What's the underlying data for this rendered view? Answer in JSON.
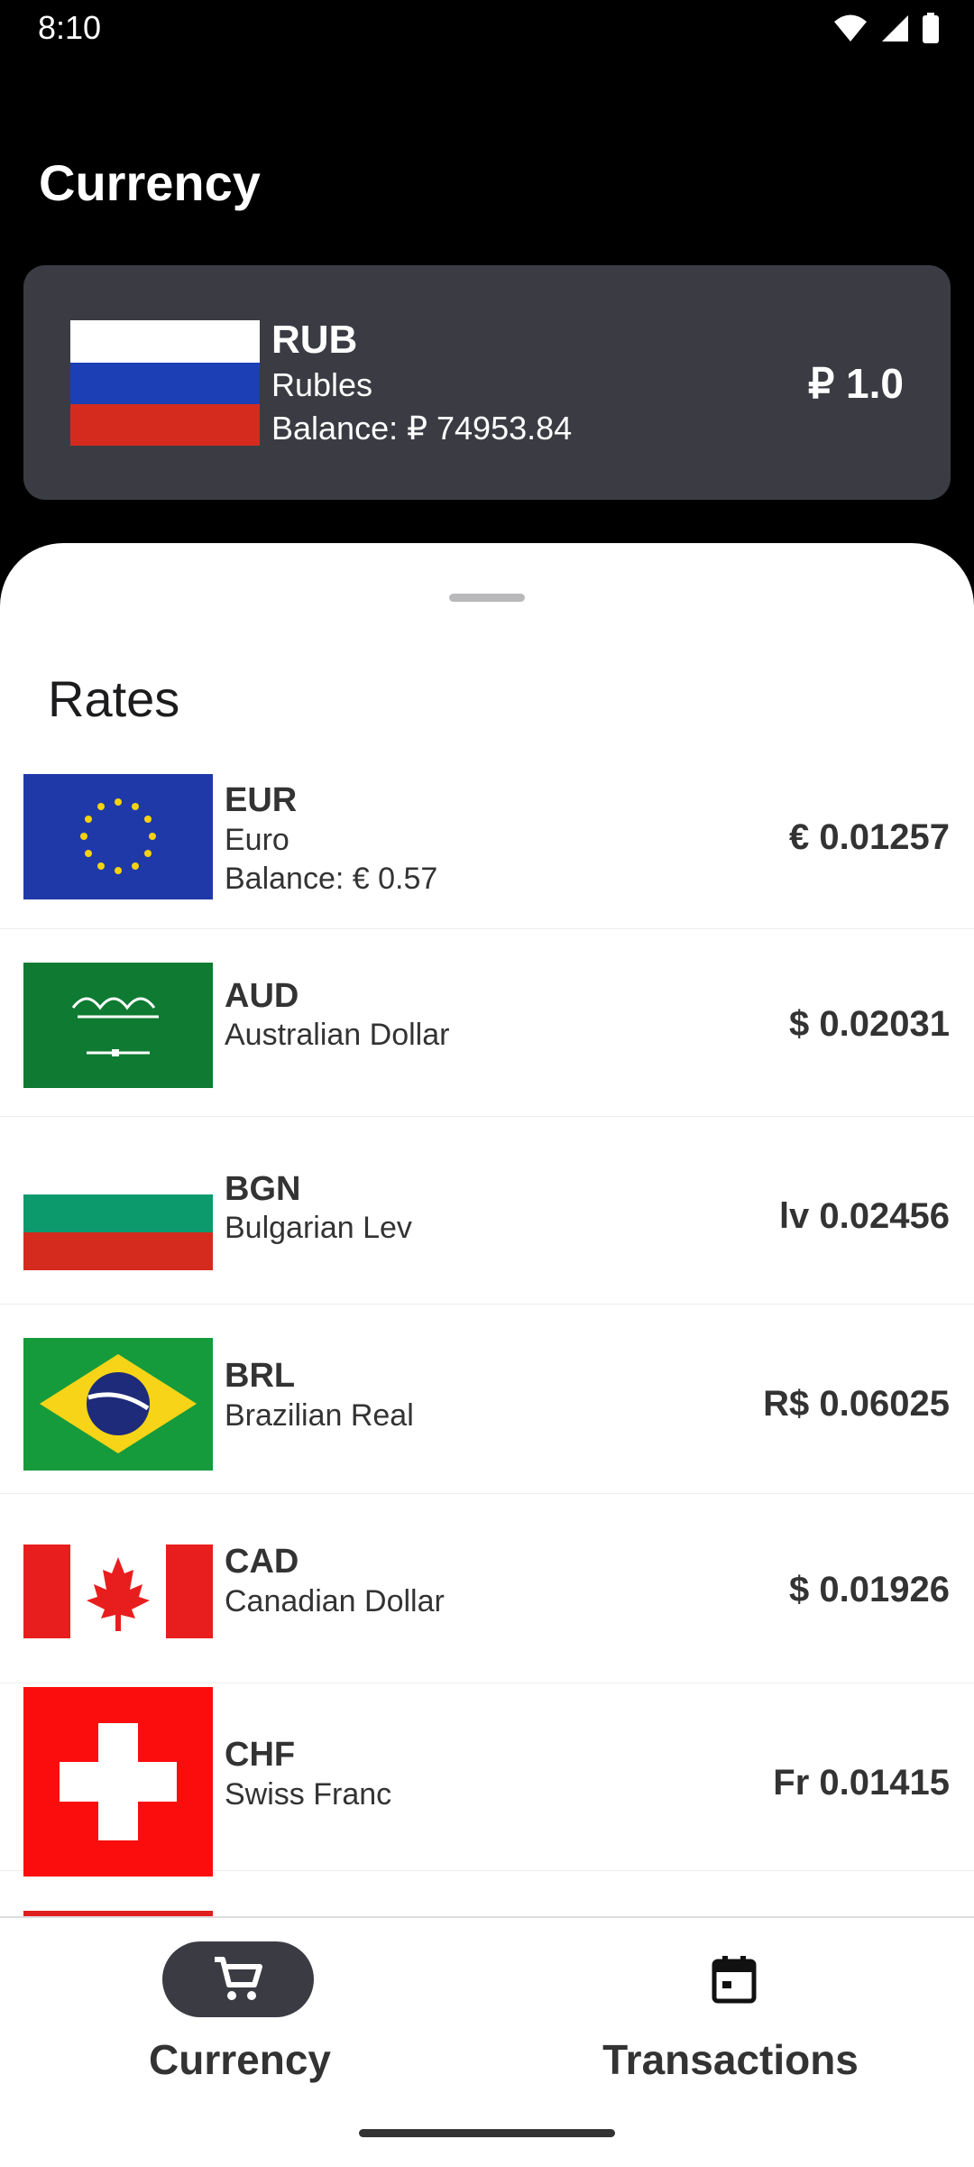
{
  "status": {
    "time": "8:10"
  },
  "page": {
    "title": "Currency"
  },
  "selected": {
    "code": "RUB",
    "name": "Rubles",
    "balance": "Balance: ₽ 74953.84",
    "rate": "₽ 1.0",
    "flag_icon": "russia-flag"
  },
  "rates": {
    "title": "Rates",
    "items": [
      {
        "code": "EUR",
        "name": "Euro",
        "balance": "Balance: € 0.57",
        "rate": "€ 0.01257",
        "flag_icon": "eu-flag"
      },
      {
        "code": "AUD",
        "name": "Australian Dollar",
        "rate": "$ 0.02031",
        "flag_icon": "saudi-flag"
      },
      {
        "code": "BGN",
        "name": "Bulgarian Lev",
        "rate": "lv 0.02456",
        "flag_icon": "bulgaria-flag"
      },
      {
        "code": "BRL",
        "name": "Brazilian Real",
        "rate": "R$ 0.06025",
        "flag_icon": "brazil-flag"
      },
      {
        "code": "CAD",
        "name": "Canadian Dollar",
        "rate": "$ 0.01926",
        "flag_icon": "canada-flag"
      },
      {
        "code": "CHF",
        "name": "Swiss Franc",
        "rate": "Fr 0.01415",
        "flag_icon": "swiss-flag"
      }
    ]
  },
  "nav": {
    "currency_label": "Currency",
    "transactions_label": "Transactions",
    "currency_icon": "cart-icon",
    "transactions_icon": "calendar-icon"
  },
  "colors": {
    "background": "#000000",
    "card": "#3b3c43",
    "sheet": "#ffffff"
  }
}
